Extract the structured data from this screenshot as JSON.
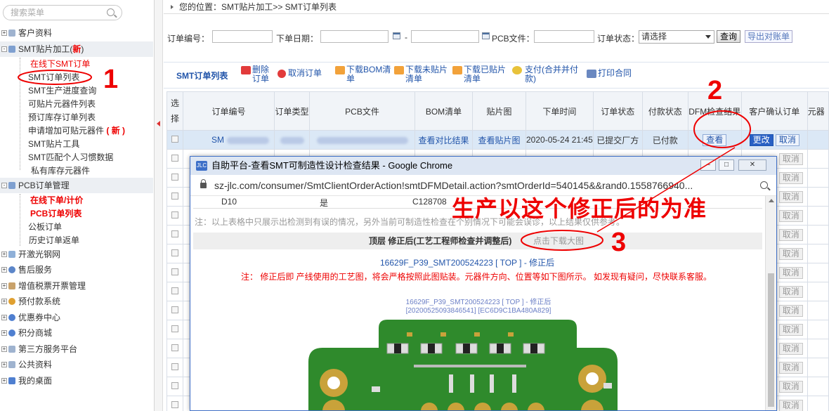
{
  "sidebar": {
    "search_placeholder": "搜索菜单",
    "groups": [
      {
        "label": "客户资料",
        "new": ""
      },
      {
        "label": "SMT贴片加工(",
        "new": "新",
        "suffix": ")"
      },
      {
        "label": "PCB订单管理"
      },
      {
        "label": "开激光钢网"
      },
      {
        "label": "售后服务"
      },
      {
        "label": "增值税票开票管理"
      },
      {
        "label": "预付款系统"
      },
      {
        "label": "优惠券中心"
      },
      {
        "label": "积分商城"
      },
      {
        "label": "第三方服务平台"
      },
      {
        "label": "公共资料"
      },
      {
        "label": "我的桌面"
      }
    ],
    "smt_items": [
      {
        "label": "在线下SMT订单"
      },
      {
        "label": "SMT订单列表"
      },
      {
        "label": "SMT生产进度查询"
      },
      {
        "label": "可贴片元器件列表"
      },
      {
        "label": "预订库存订单列表"
      },
      {
        "label": "申请增加可贴元器件",
        "new": "( 新 )"
      },
      {
        "label": "SMT贴片工具"
      },
      {
        "label": "SMT匹配个人习惯数据"
      },
      {
        "label": "私有库存元器件"
      }
    ],
    "pcb_items": [
      {
        "label": "在线下单/计价"
      },
      {
        "label": "PCB订单列表"
      },
      {
        "label": "公板订单"
      },
      {
        "label": "历史订单返单"
      }
    ]
  },
  "breadcrumb": "您的位置：SMT贴片加工>> SMT订单列表",
  "filters": {
    "order_no_label": "订单编号：",
    "order_date_label": "下单日期：",
    "date_sep": "-",
    "pcb_file_label": "PCB文件：",
    "status_label": "订单状态：",
    "status_value": "请选择",
    "search_btn": "查询",
    "export_btn": "导出对账单"
  },
  "toolbar": {
    "title": "SMT订单列表",
    "delete": "删除订单",
    "cancel": "取消订单",
    "download_bom": "下载BOM清单",
    "download_unplaced": "下载未贴片清单",
    "download_placed": "下载已贴片清单",
    "pay": "支付(合并并付款)",
    "print": "打印合同"
  },
  "table": {
    "headers": [
      "选择",
      "订单编号",
      "订单类型",
      "PCB文件",
      "BOM清单",
      "贴片图",
      "下单时间",
      "订单状态",
      "付款状态",
      "DFM检查结果",
      "客户确认订单",
      "元器"
    ],
    "row1": {
      "order_no": "SM",
      "bom": "查看对比结果",
      "placement": "查看贴片图",
      "time": "2020-05-24 21:45",
      "status": "已提交厂方",
      "pay": "已付款",
      "dfm": "查看",
      "modify": "更改",
      "cancel": "取消"
    },
    "cancel_label": "取消"
  },
  "popup": {
    "window_title": "自助平台-查看SMT可制造性设计检查结果 - Google Chrome",
    "icon_text": "JLC",
    "url": "sz-jlc.com/consumer/SmtClientOrderAction!smtDFMDetail.action?smtOrderId=540145&&rand0.1558766940...",
    "row_cells": [
      "D10",
      "是",
      "C128708"
    ],
    "note": "注：以上表格中只展示出检测到有误的情况，另外当前可制造性检查在个别情况下可能会误诊，以上结果仅供参考。",
    "layer_title": "顶层  修正后(工艺工程师检查并调整后)",
    "download_big": "点击下载大图",
    "file_link": "16629F_P39_SMT200524223  [ TOP ] - 修正后",
    "warning": "注： 修正后即 产线使用的工艺图，将会严格按照此图贴装。元器件方向、位置等如下图所示。 如发现有疑问，尽快联系客服。",
    "caption_line1": "16629F_P39_SMT200524223 [ TOP ] - 修正后",
    "caption_line2": "[20200525093846541] [EC6D9C1BA480A829]"
  },
  "annotations": {
    "n1": "1",
    "n2": "2",
    "n3": "3",
    "big_text": "生产以这个修正后的为准"
  },
  "colors": {
    "accent_blue": "#2255aa",
    "annotation_red": "#e00000",
    "pcb_green": "#2f8a2c",
    "highlight_row": "#dbe8f6"
  }
}
